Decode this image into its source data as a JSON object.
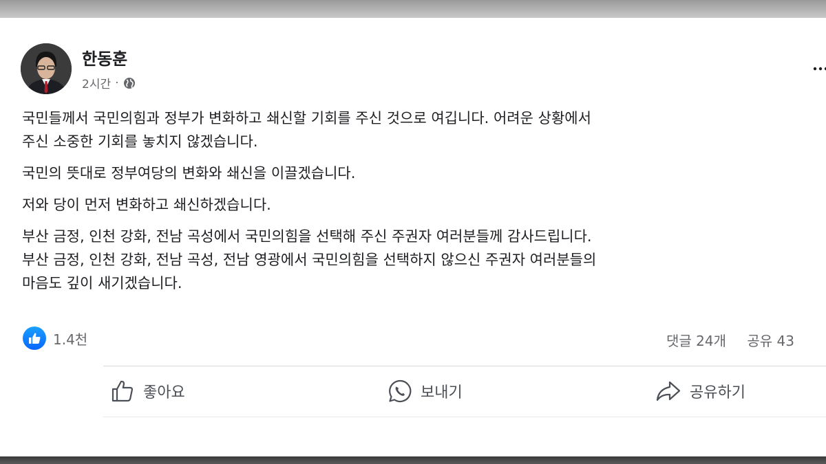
{
  "post": {
    "author": "한동훈",
    "time": "2시간",
    "separator": "·",
    "paragraphs": [
      [
        "국민들께서 국민의힘과 정부가 변화하고 쇄신할 기회를 주신 것으로 여깁니다. 어려운 상황에서",
        "주신 소중한 기회를 놓치지 않겠습니다."
      ],
      [
        "국민의 뜻대로 정부여당의 변화와 쇄신을 이끌겠습니다."
      ],
      [
        "저와 당이 먼저 변화하고 쇄신하겠습니다."
      ],
      [
        "부산 금정, 인천 강화, 전남 곡성에서 국민의힘을 선택해 주신 주권자 여러분들께 감사드립니다.",
        "부산 금정, 인천 강화, 전남 곡성, 전남 영광에서 국민의힘을 선택하지 않으신 주권자 여러분들의",
        "마음도 깊이 새기겠습니다."
      ]
    ],
    "reactions_count": "1.4천",
    "comments": "댓글 24개",
    "shares": "공유 43"
  },
  "actions": {
    "like": "좋아요",
    "send": "보내기",
    "share": "공유하기"
  },
  "colors": {
    "facebook_blue": "#0866ff",
    "secondary_text": "#65676b"
  },
  "icons": [
    "globe-icon",
    "more-options-icon",
    "like-reaction-icon",
    "thumbs-up-icon",
    "whatsapp-icon",
    "share-arrow-icon"
  ]
}
